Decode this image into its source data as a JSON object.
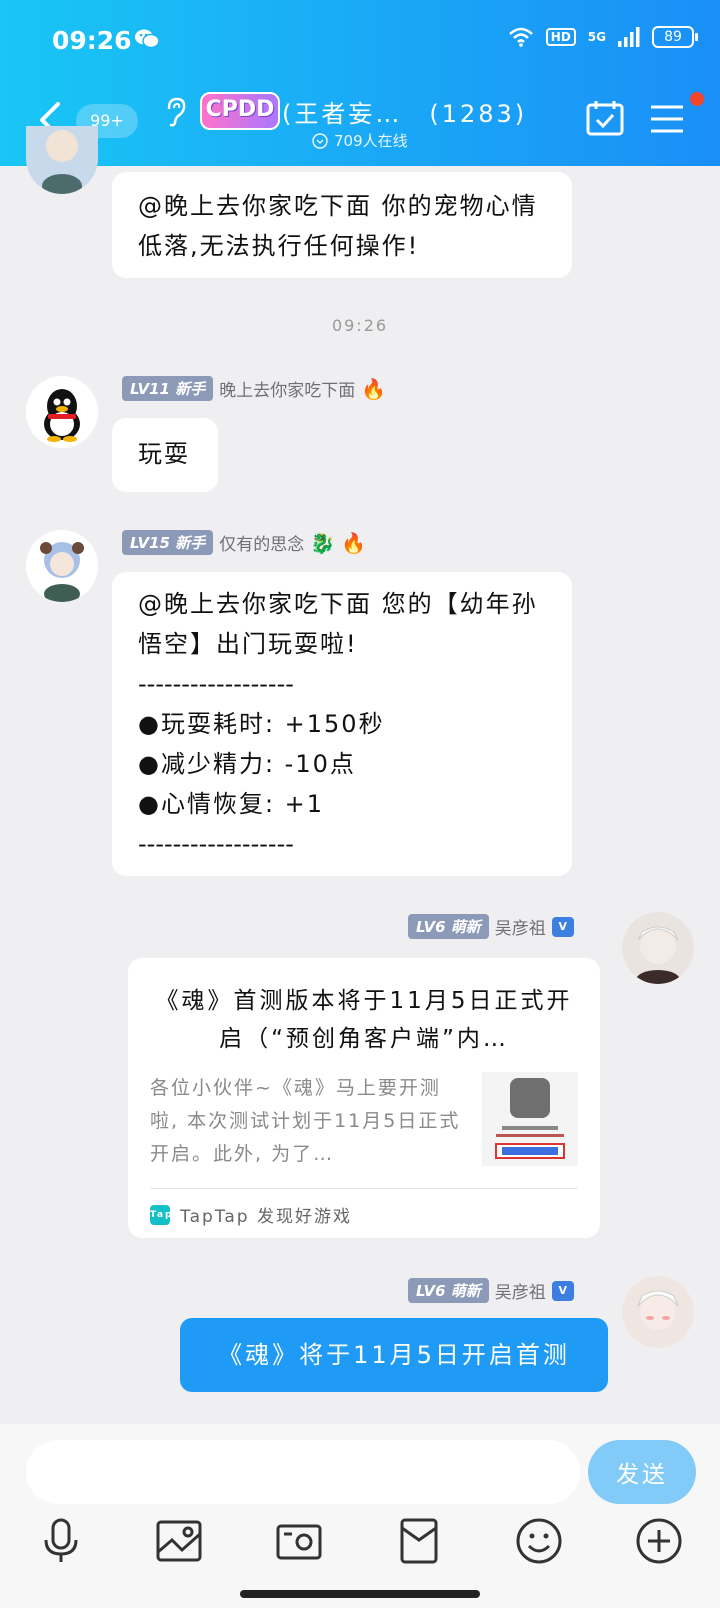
{
  "status_bar": {
    "time": "09:26",
    "battery": "89",
    "hd": "HD",
    "network": "5G"
  },
  "header": {
    "unread": "99+",
    "logo_text": "CPDD",
    "group_name": "(王者妄…　(1283)",
    "online": "709人在线"
  },
  "messages": [
    {
      "text": "@晚上去你家吃下面 你的宠物心情低落,无法执行任何操作!"
    },
    {
      "time": "09:26"
    },
    {
      "level": "LV11 新手",
      "nickname": "晚上去你家吃下面",
      "text": "玩耍"
    },
    {
      "level": "LV15 新手",
      "nickname": "仅有的思念",
      "line1": "@晚上去你家吃下面 您的【幼年孙悟空】出门玩耍啦!",
      "sep": "------------------",
      "stats": [
        "●玩耍耗时: +150秒",
        "●减少精力: -10点",
        "●心情恢复: +1"
      ],
      "sep2": "------------------"
    },
    {
      "level": "LV6 萌新",
      "nickname": "吴彦祖",
      "card": {
        "title": "《魂》首测版本将于11月5日正式开启（“预创角客户端”内…",
        "desc": "各位小伙伴~《魂》马上要开测啦, 本次测试计划于11月5日正式开启。此外, 为了…",
        "source": "TapTap 发现好游戏",
        "tap_label": "Tap"
      }
    },
    {
      "level": "LV6 萌新",
      "nickname": "吴彦祖",
      "text": "《魂》将于11月5日开启首测"
    }
  ],
  "input": {
    "placeholder": "",
    "send_label": "发送"
  },
  "colors": {
    "header": "#1aa7f6",
    "bubble_self": "#1f9bf6",
    "send": "#82caf7",
    "badge": "#8c9ab8"
  }
}
